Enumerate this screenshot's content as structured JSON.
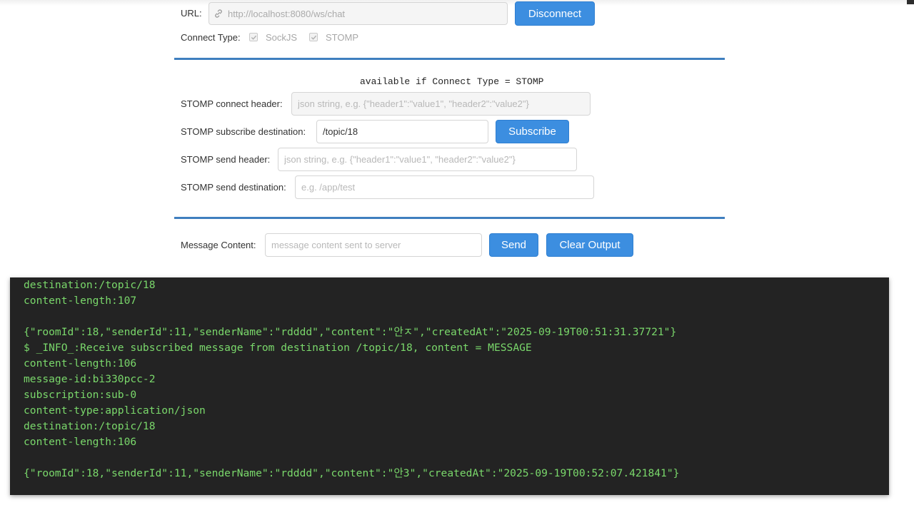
{
  "connection": {
    "url_label": "URL",
    "url_value": "http://localhost:8080/ws/chat",
    "disconnect_label": "Disconnect",
    "connect_type_label": "Connect Type",
    "sockjs_label": "SockJS",
    "stomp_label": "STOMP",
    "sockjs_checked": true,
    "stomp_checked": true
  },
  "stomp": {
    "note": "available if Connect Type = STOMP",
    "connect_header_label": "STOMP connect header",
    "connect_header_placeholder": "json string, e.g. {\"header1\":\"value1\", \"header2\":\"value2\"}",
    "subscribe_destination_label": "STOMP subscribe destination",
    "subscribe_destination_value": "/topic/18",
    "subscribe_label": "Subscribe",
    "send_header_label": "STOMP send header",
    "send_header_placeholder": "json string, e.g. {\"header1\":\"value1\", \"header2\":\"value2\"}",
    "send_destination_label": "STOMP send destination",
    "send_destination_placeholder": "e.g. /app/test"
  },
  "message": {
    "content_label": "Message Content",
    "content_placeholder": "message content sent to server",
    "send_label": "Send",
    "clear_label": "Clear Output"
  },
  "colors": {
    "accent": "#3c8ee0",
    "divider": "#3f7fbf",
    "console_bg": "#232323",
    "console_text": "#7ad86b"
  },
  "console": {
    "lines": [
      "destination:/topic/18",
      "content-length:107",
      "",
      "{\"roomId\":18,\"senderId\":11,\"senderName\":\"rdddd\",\"content\":\"안ㅈ\",\"createdAt\":\"2025-09-19T00:51:31.37721\"}",
      "$ _INFO_:Receive subscribed message from destination /topic/18, content = MESSAGE",
      "content-length:106",
      "message-id:bi330pcc-2",
      "subscription:sub-0",
      "content-type:application/json",
      "destination:/topic/18",
      "content-length:106",
      "",
      "{\"roomId\":18,\"senderId\":11,\"senderName\":\"rdddd\",\"content\":\"안3\",\"createdAt\":\"2025-09-19T00:52:07.421841\"}"
    ]
  }
}
